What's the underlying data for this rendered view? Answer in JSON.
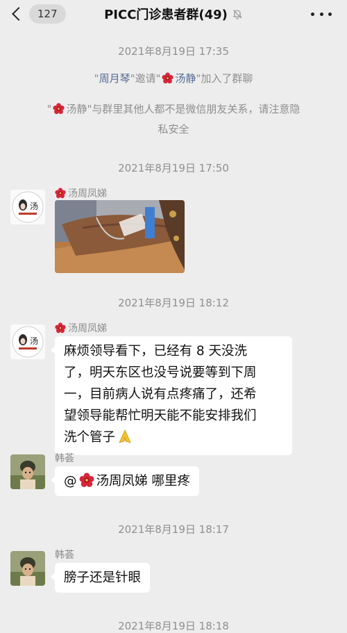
{
  "header": {
    "unread_count": "127",
    "title": "PICC门诊患者群(49)"
  },
  "timestamps": [
    "2021年8月19日 17:35",
    "2021年8月19日 17:50",
    "2021年8月19日 18:12",
    "2021年8月19日 18:17",
    "2021年8月19日 18:18"
  ],
  "system": {
    "invite": {
      "q1": "\"",
      "inviter": "周月琴",
      "q2": "\"邀请\"",
      "invitee": "汤静",
      "q3": "\"加入了群聊"
    },
    "privacy": {
      "q1": "\"",
      "name": "汤静",
      "line1_rest": "\"与群里其他人都不是微信朋友关系，请注意隐",
      "line2": "私安全"
    }
  },
  "messages": [
    {
      "sender": "汤周凤娣",
      "type": "image"
    },
    {
      "sender": "汤周凤娣",
      "lines": [
        "麻烦领导看下，已经有 8 天没洗",
        "了，明天东区也没号说要等到下周",
        "一，目前病人说有点疼痛了，还希",
        "望领导能帮忙明天能不能安排我们",
        "洗个管子"
      ]
    },
    {
      "sender": "韩荟",
      "at": "@",
      "mention": "汤周凤娣",
      "text": "哪里疼"
    },
    {
      "sender": "韩荟",
      "text": "膀子还是针眼"
    }
  ],
  "colors": {
    "background": "#ededed",
    "bubble": "#ffffff",
    "link": "#576b95",
    "muted_text": "#8f8f8f"
  },
  "icons": [
    "back-chevron-icon",
    "mute-bell-icon",
    "more-dots-icon",
    "hibiscus-flower-icon",
    "praying-hands-emoji"
  ]
}
